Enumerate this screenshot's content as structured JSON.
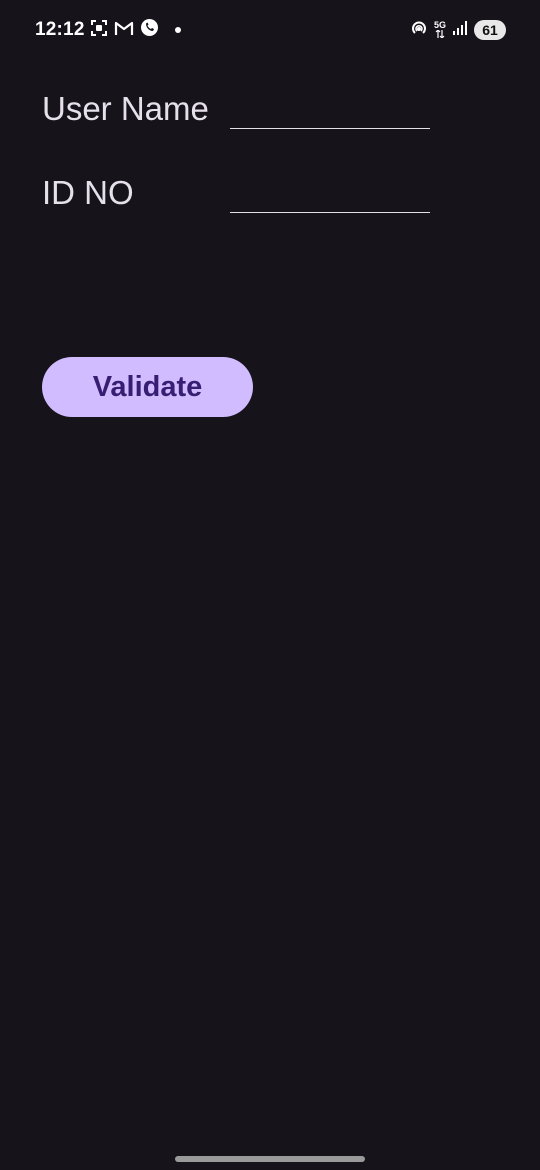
{
  "status_bar": {
    "time": "12:12",
    "network": "5G",
    "battery": "61",
    "left_icons": [
      "screenshot-icon",
      "gmail-icon",
      "phone-call-icon"
    ],
    "right_icons": [
      "hotspot-icon",
      "5g-icon",
      "signal-icon",
      "battery-icon"
    ]
  },
  "form": {
    "username_label": "User Name",
    "username_value": "",
    "id_label": "ID NO",
    "id_value": ""
  },
  "validate_button": {
    "label": "Validate"
  },
  "colors": {
    "background": "#16131b",
    "text": "#e6e0ea",
    "button_bg": "#d0bcff",
    "button_text": "#381e72"
  }
}
